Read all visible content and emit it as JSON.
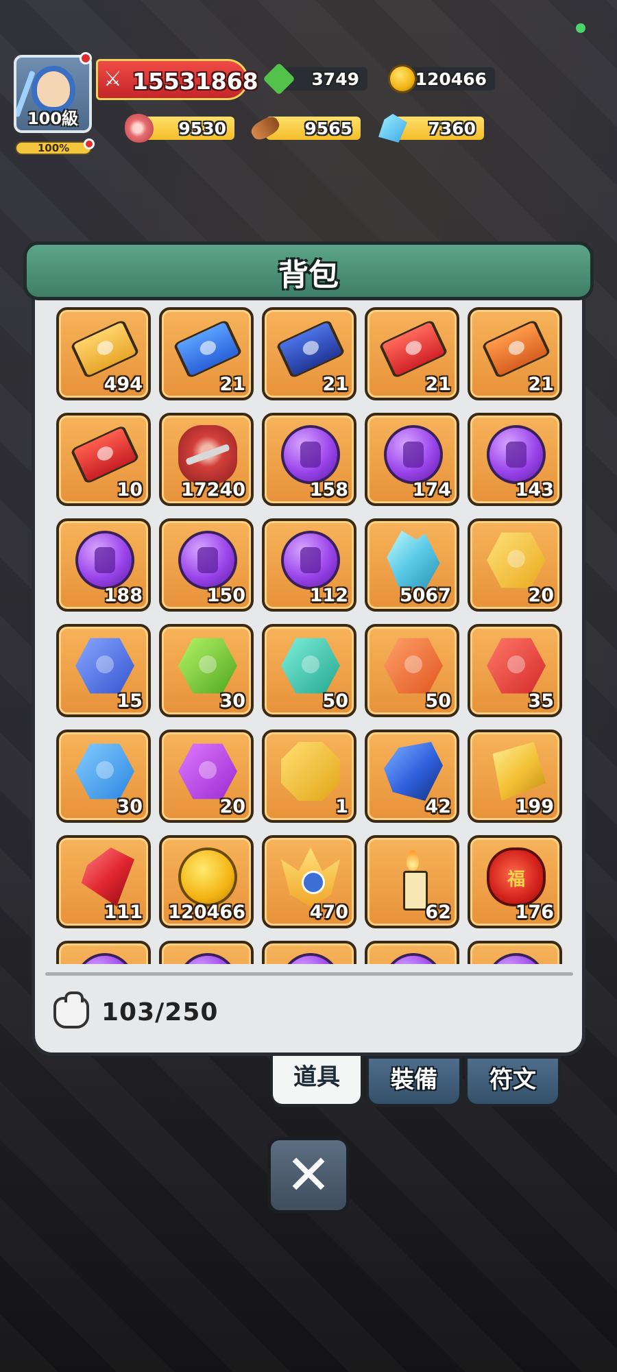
{
  "hud": {
    "avatar_level": "100級",
    "exp_percent": "100%",
    "combat_power": "15531868",
    "gems": "3749",
    "gold": "120466",
    "meat": "9530",
    "wood": "9565",
    "crystal": "7360"
  },
  "panel": {
    "title": "背包",
    "capacity": "103/250"
  },
  "items": [
    {
      "icon": "gold-ticket-icon",
      "count": "494"
    },
    {
      "icon": "blue-shield-ticket-icon",
      "count": "21"
    },
    {
      "icon": "blue-helmet-ticket-icon",
      "count": "21"
    },
    {
      "icon": "red-drop-ticket-icon",
      "count": "21"
    },
    {
      "icon": "orange-lightning-ticket-icon",
      "count": "21"
    },
    {
      "icon": "red-fire-ticket-icon",
      "count": "10"
    },
    {
      "icon": "red-meat-icon",
      "count": "17240"
    },
    {
      "icon": "purple-sword-orb-icon",
      "count": "158"
    },
    {
      "icon": "purple-shield-orb-icon",
      "count": "174"
    },
    {
      "icon": "purple-ring-orb-icon",
      "count": "143"
    },
    {
      "icon": "purple-helmet-orb-icon",
      "count": "188"
    },
    {
      "icon": "purple-armor-orb-icon",
      "count": "150"
    },
    {
      "icon": "purple-boots-orb-icon",
      "count": "112"
    },
    {
      "icon": "blue-crystal-cluster-icon",
      "count": "5067"
    },
    {
      "icon": "gold-lightning-stone-icon",
      "count": "20"
    },
    {
      "icon": "blue-moon-stone-icon",
      "count": "15"
    },
    {
      "icon": "green-star-stone-icon",
      "count": "30"
    },
    {
      "icon": "teal-fist-stone-icon",
      "count": "50"
    },
    {
      "icon": "orange-flame-stone-icon",
      "count": "50"
    },
    {
      "icon": "red-drop-stone-icon",
      "count": "35"
    },
    {
      "icon": "blue-snowflake-stone-icon",
      "count": "30"
    },
    {
      "icon": "purple-skull-stone-icon",
      "count": "20"
    },
    {
      "icon": "gold-shield-stone-icon",
      "count": "1"
    },
    {
      "icon": "blue-sapphire-icon",
      "count": "42"
    },
    {
      "icon": "gold-bar-icon",
      "count": "199"
    },
    {
      "icon": "red-ruby-icon",
      "count": "111"
    },
    {
      "icon": "gold-coin-icon",
      "count": "120466"
    },
    {
      "icon": "crown-badge-icon",
      "count": "470"
    },
    {
      "icon": "candle-icon",
      "count": "62"
    },
    {
      "icon": "red-lantern-icon",
      "count": "176"
    },
    {
      "icon": "partial-item-icon",
      "count": ""
    },
    {
      "icon": "partial-item-icon",
      "count": ""
    },
    {
      "icon": "partial-item-icon",
      "count": ""
    },
    {
      "icon": "partial-item-icon",
      "count": ""
    },
    {
      "icon": "partial-item-icon",
      "count": ""
    }
  ],
  "tabs": [
    {
      "label": "道具",
      "active": true
    },
    {
      "label": "裝備",
      "active": false
    },
    {
      "label": "符文",
      "active": false
    }
  ],
  "close_button": "✕",
  "colors": {
    "slot": "#f0a048",
    "header": "#4f9278",
    "tab_inactive": "#3f5c78",
    "power_bar": "#d93a38"
  }
}
